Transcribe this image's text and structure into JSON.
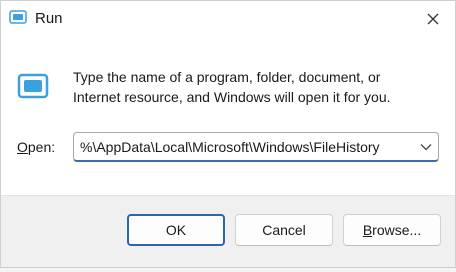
{
  "window": {
    "title": "Run",
    "icon": "run-icon"
  },
  "description": {
    "line1": "Type the name of a program, folder, document, or",
    "line2": "Internet resource, and Windows will open it for you."
  },
  "open": {
    "label_underlined": "O",
    "label_rest": "pen:",
    "value": "%\\AppData\\Local\\Microsoft\\Windows\\FileHistory"
  },
  "buttons": {
    "ok": "OK",
    "cancel": "Cancel",
    "browse_prefix": "",
    "browse_underlined": "B",
    "browse_rest": "rowse..."
  },
  "colors": {
    "accent": "#2f64a8",
    "icon_blue": "#3aa0e0"
  }
}
